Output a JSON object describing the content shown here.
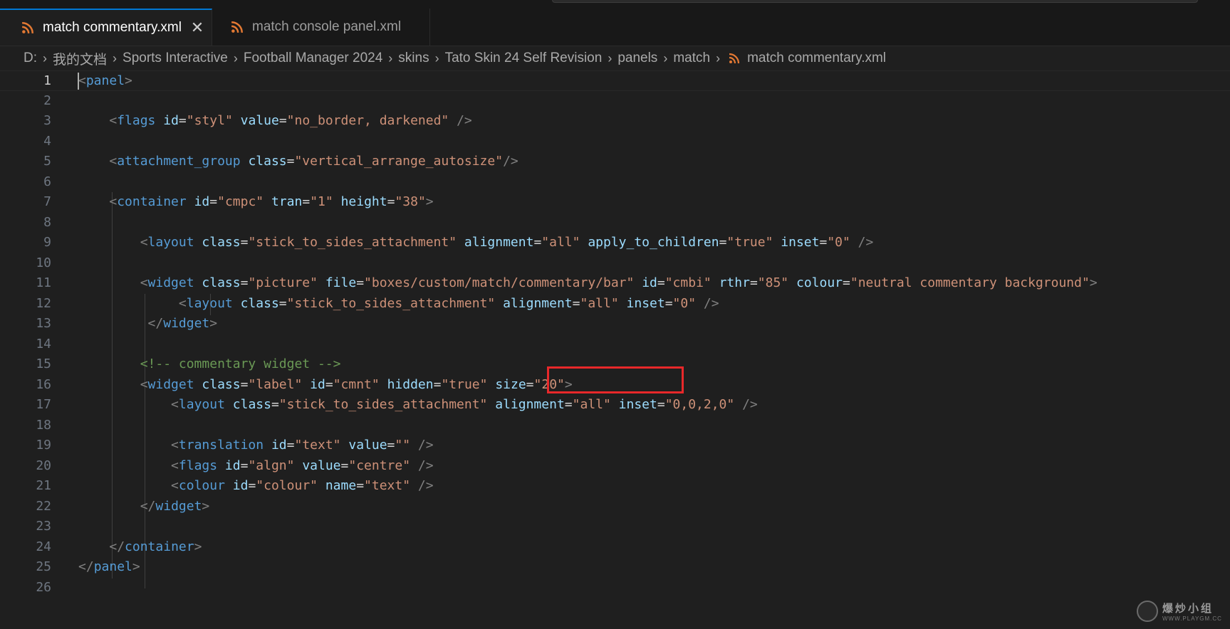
{
  "tabs": [
    {
      "label": "match commentary.xml",
      "active": true,
      "icon": "rss-icon"
    },
    {
      "label": "match console panel.xml",
      "active": false,
      "icon": "rss-icon"
    }
  ],
  "tab_close_glyph": "✕",
  "breadcrumbs": [
    "D:",
    "我的文档",
    "Sports Interactive",
    "Football Manager 2024",
    "skins",
    "Tato Skin 24 Self Revision",
    "panels",
    "match",
    "match commentary.xml"
  ],
  "code_lines": [
    [
      [
        "br",
        "<"
      ],
      [
        "tag",
        "panel"
      ],
      [
        "br",
        ">"
      ]
    ],
    [],
    [
      [
        "txt",
        "    "
      ],
      [
        "br",
        "<"
      ],
      [
        "tag",
        "flags"
      ],
      [
        "txt",
        " "
      ],
      [
        "attr",
        "id"
      ],
      [
        "txt",
        "="
      ],
      [
        "val",
        "\"styl\""
      ],
      [
        "txt",
        " "
      ],
      [
        "attr",
        "value"
      ],
      [
        "txt",
        "="
      ],
      [
        "val",
        "\"no_border, darkened\""
      ],
      [
        "txt",
        " "
      ],
      [
        "br",
        "/>"
      ]
    ],
    [],
    [
      [
        "txt",
        "    "
      ],
      [
        "br",
        "<"
      ],
      [
        "tag",
        "attachment_group"
      ],
      [
        "txt",
        " "
      ],
      [
        "attr",
        "class"
      ],
      [
        "txt",
        "="
      ],
      [
        "val",
        "\"vertical_arrange_autosize\""
      ],
      [
        "br",
        "/>"
      ]
    ],
    [],
    [
      [
        "txt",
        "    "
      ],
      [
        "br",
        "<"
      ],
      [
        "tag",
        "container"
      ],
      [
        "txt",
        " "
      ],
      [
        "attr",
        "id"
      ],
      [
        "txt",
        "="
      ],
      [
        "val",
        "\"cmpc\""
      ],
      [
        "txt",
        " "
      ],
      [
        "attr",
        "tran"
      ],
      [
        "txt",
        "="
      ],
      [
        "val",
        "\"1\""
      ],
      [
        "txt",
        " "
      ],
      [
        "attr",
        "height"
      ],
      [
        "txt",
        "="
      ],
      [
        "val",
        "\"38\""
      ],
      [
        "br",
        ">"
      ]
    ],
    [],
    [
      [
        "txt",
        "        "
      ],
      [
        "br",
        "<"
      ],
      [
        "tag",
        "layout"
      ],
      [
        "txt",
        " "
      ],
      [
        "attr",
        "class"
      ],
      [
        "txt",
        "="
      ],
      [
        "val",
        "\"stick_to_sides_attachment\""
      ],
      [
        "txt",
        " "
      ],
      [
        "attr",
        "alignment"
      ],
      [
        "txt",
        "="
      ],
      [
        "val",
        "\"all\""
      ],
      [
        "txt",
        " "
      ],
      [
        "attr",
        "apply_to_children"
      ],
      [
        "txt",
        "="
      ],
      [
        "val",
        "\"true\""
      ],
      [
        "txt",
        " "
      ],
      [
        "attr",
        "inset"
      ],
      [
        "txt",
        "="
      ],
      [
        "val",
        "\"0\""
      ],
      [
        "txt",
        " "
      ],
      [
        "br",
        "/>"
      ]
    ],
    [],
    [
      [
        "txt",
        "        "
      ],
      [
        "br",
        "<"
      ],
      [
        "tag",
        "widget"
      ],
      [
        "txt",
        " "
      ],
      [
        "attr",
        "class"
      ],
      [
        "txt",
        "="
      ],
      [
        "val",
        "\"picture\""
      ],
      [
        "txt",
        " "
      ],
      [
        "attr",
        "file"
      ],
      [
        "txt",
        "="
      ],
      [
        "val",
        "\"boxes/custom/match/commentary/bar\""
      ],
      [
        "txt",
        " "
      ],
      [
        "attr",
        "id"
      ],
      [
        "txt",
        "="
      ],
      [
        "val",
        "\"cmbi\""
      ],
      [
        "txt",
        " "
      ],
      [
        "attr",
        "rthr"
      ],
      [
        "txt",
        "="
      ],
      [
        "val",
        "\"85\""
      ],
      [
        "txt",
        " "
      ],
      [
        "attr",
        "colour"
      ],
      [
        "txt",
        "="
      ],
      [
        "val",
        "\"neutral commentary background\""
      ],
      [
        "br",
        ">"
      ]
    ],
    [
      [
        "txt",
        "             "
      ],
      [
        "br",
        "<"
      ],
      [
        "tag",
        "layout"
      ],
      [
        "txt",
        " "
      ],
      [
        "attr",
        "class"
      ],
      [
        "txt",
        "="
      ],
      [
        "val",
        "\"stick_to_sides_attachment\""
      ],
      [
        "txt",
        " "
      ],
      [
        "attr",
        "alignment"
      ],
      [
        "txt",
        "="
      ],
      [
        "val",
        "\"all\""
      ],
      [
        "txt",
        " "
      ],
      [
        "attr",
        "inset"
      ],
      [
        "txt",
        "="
      ],
      [
        "val",
        "\"0\""
      ],
      [
        "txt",
        " "
      ],
      [
        "br",
        "/>"
      ]
    ],
    [
      [
        "txt",
        "         "
      ],
      [
        "br",
        "</"
      ],
      [
        "tag",
        "widget"
      ],
      [
        "br",
        ">"
      ]
    ],
    [],
    [
      [
        "txt",
        "        "
      ],
      [
        "com",
        "<!-- commentary widget -->"
      ]
    ],
    [
      [
        "txt",
        "        "
      ],
      [
        "br",
        "<"
      ],
      [
        "tag",
        "widget"
      ],
      [
        "txt",
        " "
      ],
      [
        "attr",
        "class"
      ],
      [
        "txt",
        "="
      ],
      [
        "val",
        "\"label\""
      ],
      [
        "txt",
        " "
      ],
      [
        "attr",
        "id"
      ],
      [
        "txt",
        "="
      ],
      [
        "val",
        "\"cmnt\""
      ],
      [
        "txt",
        " "
      ],
      [
        "attr",
        "hidden"
      ],
      [
        "txt",
        "="
      ],
      [
        "val",
        "\"true\""
      ],
      [
        "txt",
        " "
      ],
      [
        "attr",
        "size"
      ],
      [
        "txt",
        "="
      ],
      [
        "val",
        "\"20\""
      ],
      [
        "br",
        ">"
      ]
    ],
    [
      [
        "txt",
        "            "
      ],
      [
        "br",
        "<"
      ],
      [
        "tag",
        "layout"
      ],
      [
        "txt",
        " "
      ],
      [
        "attr",
        "class"
      ],
      [
        "txt",
        "="
      ],
      [
        "val",
        "\"stick_to_sides_attachment\""
      ],
      [
        "txt",
        " "
      ],
      [
        "attr",
        "alignment"
      ],
      [
        "txt",
        "="
      ],
      [
        "val",
        "\"all\""
      ],
      [
        "txt",
        " "
      ],
      [
        "attr",
        "inset"
      ],
      [
        "txt",
        "="
      ],
      [
        "val",
        "\"0,0,2,0\""
      ],
      [
        "txt",
        " "
      ],
      [
        "br",
        "/>"
      ]
    ],
    [],
    [
      [
        "txt",
        "            "
      ],
      [
        "br",
        "<"
      ],
      [
        "tag",
        "translation"
      ],
      [
        "txt",
        " "
      ],
      [
        "attr",
        "id"
      ],
      [
        "txt",
        "="
      ],
      [
        "val",
        "\"text\""
      ],
      [
        "txt",
        " "
      ],
      [
        "attr",
        "value"
      ],
      [
        "txt",
        "="
      ],
      [
        "val",
        "\"\""
      ],
      [
        "txt",
        " "
      ],
      [
        "br",
        "/>"
      ]
    ],
    [
      [
        "txt",
        "            "
      ],
      [
        "br",
        "<"
      ],
      [
        "tag",
        "flags"
      ],
      [
        "txt",
        " "
      ],
      [
        "attr",
        "id"
      ],
      [
        "txt",
        "="
      ],
      [
        "val",
        "\"algn\""
      ],
      [
        "txt",
        " "
      ],
      [
        "attr",
        "value"
      ],
      [
        "txt",
        "="
      ],
      [
        "val",
        "\"centre\""
      ],
      [
        "txt",
        " "
      ],
      [
        "br",
        "/>"
      ]
    ],
    [
      [
        "txt",
        "            "
      ],
      [
        "br",
        "<"
      ],
      [
        "tag",
        "colour"
      ],
      [
        "txt",
        " "
      ],
      [
        "attr",
        "id"
      ],
      [
        "txt",
        "="
      ],
      [
        "val",
        "\"colour\""
      ],
      [
        "txt",
        " "
      ],
      [
        "attr",
        "name"
      ],
      [
        "txt",
        "="
      ],
      [
        "val",
        "\"text\""
      ],
      [
        "txt",
        " "
      ],
      [
        "br",
        "/>"
      ]
    ],
    [
      [
        "txt",
        "        "
      ],
      [
        "br",
        "</"
      ],
      [
        "tag",
        "widget"
      ],
      [
        "br",
        ">"
      ]
    ],
    [],
    [
      [
        "txt",
        "    "
      ],
      [
        "br",
        "</"
      ],
      [
        "tag",
        "container"
      ],
      [
        "br",
        ">"
      ]
    ],
    [
      [
        "br",
        "</"
      ],
      [
        "tag",
        "panel"
      ],
      [
        "br",
        ">"
      ]
    ],
    []
  ],
  "current_line": 1,
  "watermark": {
    "cn": "爆炒小组",
    "url": "WWW.PLAYGM.CC"
  },
  "colors": {
    "accent": "#0078d4",
    "rss": "#e37933",
    "highlight_box": "#e8282a"
  }
}
